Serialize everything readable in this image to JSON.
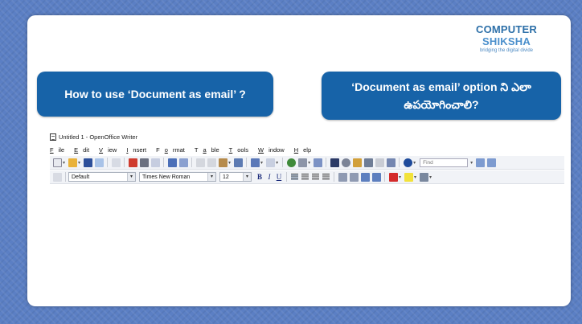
{
  "logo": {
    "part1": "COMPUTER ",
    "part2": "SHIKSHA",
    "tagline": "bridging the digital divide"
  },
  "left_box": {
    "text": "How to use ‘Document as email’ ?"
  },
  "right_box": {
    "line1": "‘Document as email’ option ని ఎలా",
    "line2": "ఉపయోగించాలి?"
  },
  "window": {
    "title": "Untitled 1 - OpenOffice Writer"
  },
  "menu": [
    {
      "u": "F",
      "rest": "ile"
    },
    {
      "u": "E",
      "rest": "dit"
    },
    {
      "u": "V",
      "rest": "iew"
    },
    {
      "u": "I",
      "rest": "nsert"
    },
    {
      "pre": "F",
      "u": "o",
      "rest": "rmat"
    },
    {
      "pre": "T",
      "u": "a",
      "rest": "ble"
    },
    {
      "u": "T",
      "rest": "ools"
    },
    {
      "u": "W",
      "rest": "indow"
    },
    {
      "u": "H",
      "rest": "elp"
    }
  ],
  "find": {
    "placeholder": "Find"
  },
  "format_bar": {
    "style": "Default",
    "font": "Times New Roman",
    "size": "12",
    "bold": "B",
    "italic": "I",
    "underline": "U"
  },
  "colors": {
    "accent": "#1763a8",
    "background": "#5b7fc4"
  }
}
